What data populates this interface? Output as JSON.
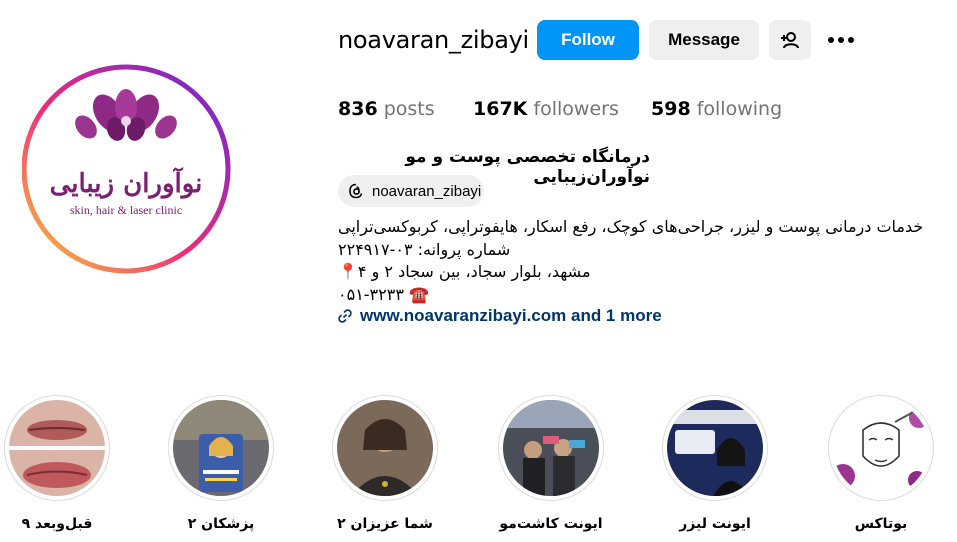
{
  "profile": {
    "username": "noavaran_zibayi",
    "full_name": "درمانگاه تخصصی پوست و مو نوآوران‌زیبایی",
    "logo_title": "نوآوران زیبایی",
    "logo_subtitle": "skin, hair & laser clinic"
  },
  "actions": {
    "follow": "Follow",
    "message": "Message",
    "suggest_icon": "add-person-icon",
    "more_icon": "more-horizontal-icon"
  },
  "stats": {
    "posts_count": "836",
    "posts_label": "posts",
    "followers_count": "167K",
    "followers_label": "followers",
    "following_count": "598",
    "following_label": "following"
  },
  "threads": {
    "handle": "noavaran_zibayi",
    "icon": "threads-icon"
  },
  "bio": {
    "line1": "خدمات درمانی پوست و لیزر، جراحی‌های کوچک، رفع اسکار، هایفوتراپی، کربوکسی‌تراپی",
    "line2": "شماره پروانه: ۰۳-۲۲۴۹۱۷",
    "line3": "مشهد، بلوار سجاد، بین سجاد ۲ و ۴",
    "line4": "۰۵۱-۳۲۳۳",
    "pin_icon": "📍",
    "phone_icon": "☎️"
  },
  "link": {
    "text": "www.noavaranzibayi.com and 1 more",
    "icon": "link-icon"
  },
  "highlights": [
    {
      "label": "قبل‌وبعد ۹"
    },
    {
      "label": "پزشکان ۲"
    },
    {
      "label": "شما عزیزان ۲"
    },
    {
      "label": "ایونت کاشت‌مو"
    },
    {
      "label": "ایونت لیزر"
    },
    {
      "label": "بوتاکس"
    }
  ],
  "colors": {
    "follow_bg": "#0095f6",
    "secondary_bg": "#efefef",
    "link": "#00376b",
    "logo_purple": "#7b1f73",
    "ring_start": "#f9ce34",
    "ring_mid": "#ee2a7b",
    "ring_end": "#6228d7"
  }
}
